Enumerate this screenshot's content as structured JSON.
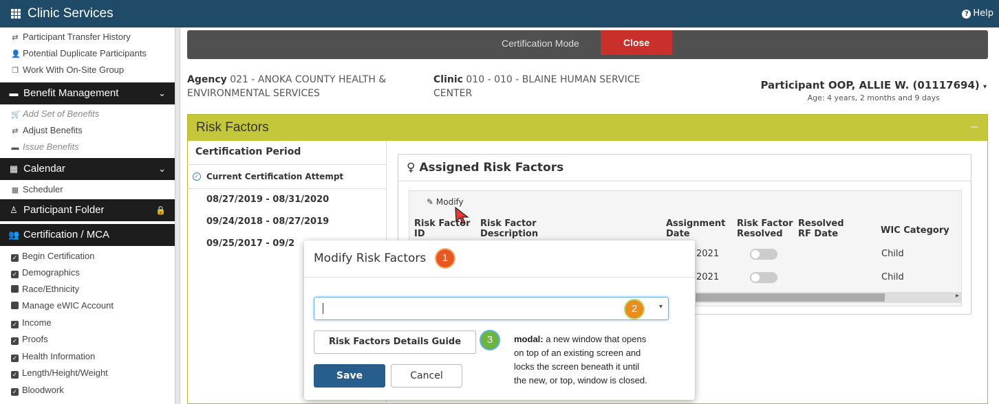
{
  "app": {
    "title": "Clinic Services",
    "help_label": "Help"
  },
  "sidebar": {
    "items_top": [
      {
        "label": "Participant Transfer History",
        "icon": "transfer-icon"
      },
      {
        "label": "Potential Duplicate Participants",
        "icon": "users-icon"
      },
      {
        "label": "Work With On-Site Group",
        "icon": "window-icon"
      }
    ],
    "benefit_management": {
      "title": "Benefit Management",
      "items": [
        {
          "label": "Add Set of Benefits",
          "disabled": true
        },
        {
          "label": "Adjust Benefits",
          "disabled": false
        },
        {
          "label": "Issue Benefits",
          "disabled": true
        }
      ]
    },
    "calendar": {
      "title": "Calendar",
      "items": [
        {
          "label": "Scheduler"
        }
      ]
    },
    "participant_folder": {
      "title": "Participant Folder"
    },
    "certification": {
      "title": "Certification / MCA",
      "items": [
        {
          "label": "Begin Certification",
          "checked": true
        },
        {
          "label": "Demographics",
          "checked": true
        },
        {
          "label": "Race/Ethnicity",
          "checked": false
        },
        {
          "label": "Manage eWIC Account",
          "checked": false
        },
        {
          "label": "Income",
          "checked": true
        },
        {
          "label": "Proofs",
          "checked": true
        },
        {
          "label": "Health Information",
          "checked": true
        },
        {
          "label": "Length/Height/Weight",
          "checked": true
        },
        {
          "label": "Bloodwork",
          "checked": true
        }
      ]
    }
  },
  "modebar": {
    "mode_label": "Certification Mode",
    "close_label": "Close"
  },
  "context": {
    "agency_label": "Agency",
    "agency_line1": "021 - ANOKA COUNTY HEALTH &",
    "agency_line2": "ENVIRONMENTAL SERVICES",
    "clinic_label": "Clinic",
    "clinic_line1": "010 - 010 - BLAINE HUMAN SERVICE",
    "clinic_line2": "CENTER",
    "participant_label": "Participant",
    "participant_name": "OOP, ALLIE W. (01117694)",
    "participant_age": "Age: 4 years, 2 months and 9 days"
  },
  "risk_panel": {
    "title": "Risk Factors",
    "collapse": "−",
    "cert_period_title": "Certification Period",
    "current_attempt": "Current Certification Attempt",
    "periods": [
      "08/27/2019 - 08/31/2020",
      "09/24/2018 - 08/27/2019",
      "09/25/2017 - 09/2"
    ],
    "assigned_title": "Assigned Risk Factors",
    "modify_label": "Modify",
    "columns": {
      "id_1": "Risk Factor",
      "id_2": "ID",
      "desc_1": "Risk Factor",
      "desc_2": "Description",
      "date_1": "Assignment",
      "date_2": "Date",
      "resolved_1": "Risk Factor",
      "resolved_2": "Resolved",
      "rfdate_1": "Resolved",
      "rfdate_2": "RF Date",
      "wic": "WIC Category"
    },
    "rows": [
      {
        "date": "2021",
        "wic": "Child"
      },
      {
        "date": "2021",
        "wic": "Child"
      }
    ]
  },
  "modal": {
    "title": "Modify Risk Factors",
    "select_value": "",
    "guide_label": "Risk Factors Details Guide",
    "save_label": "Save",
    "cancel_label": "Cancel",
    "note_term": "modal:",
    "note_line1": " a new window that opens",
    "note_line2": "on top of an existing screen and",
    "note_line3": "locks the screen beneath it until",
    "note_line4": "the new, or top, window is closed."
  },
  "badges": [
    "1",
    "2",
    "3"
  ]
}
